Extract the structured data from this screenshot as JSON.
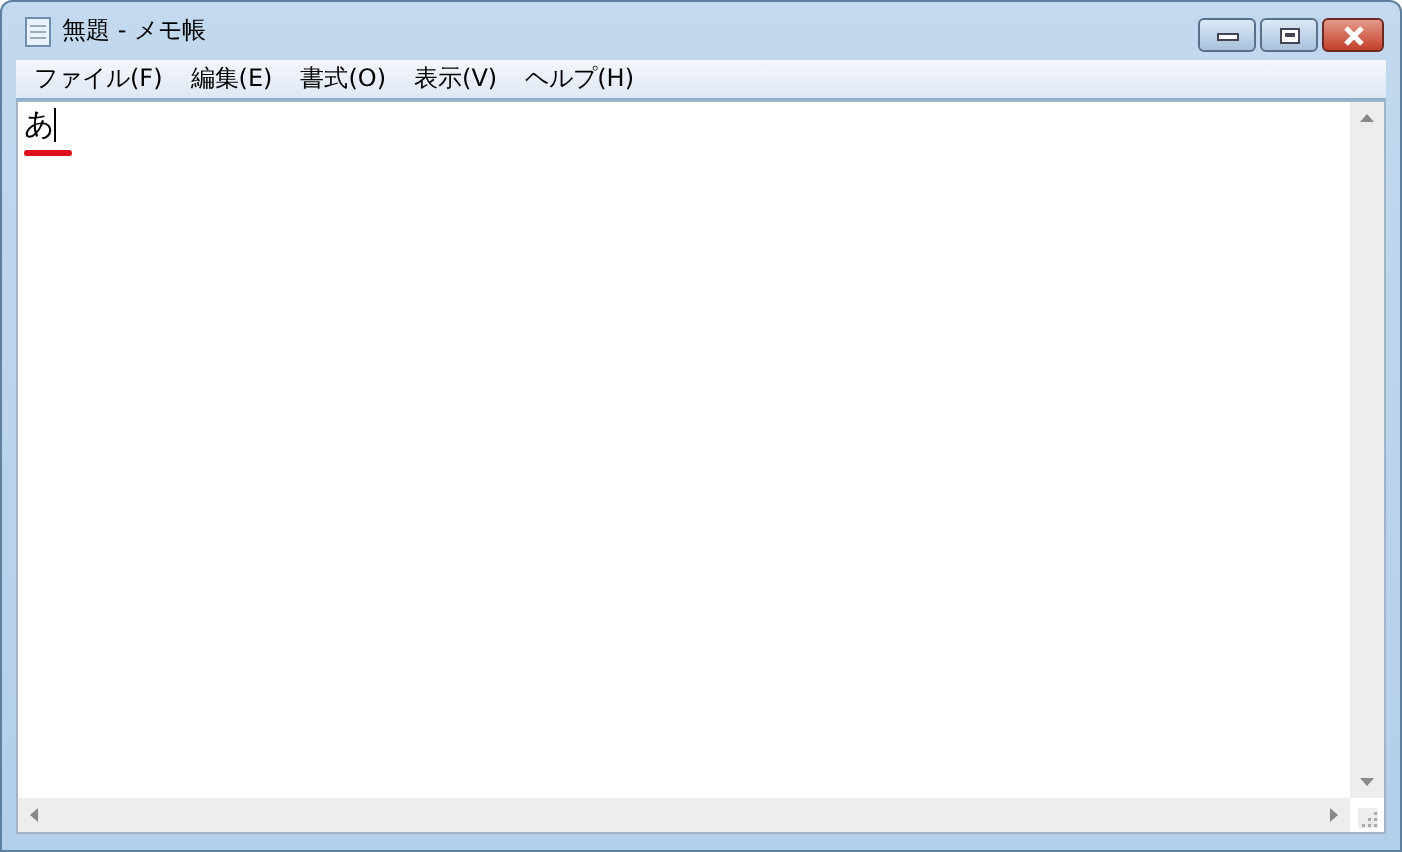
{
  "window": {
    "title": "無題 - メモ帳"
  },
  "menu": [
    {
      "label": "ファイル(F)"
    },
    {
      "label": "編集(E)"
    },
    {
      "label": "書式(O)"
    },
    {
      "label": "表示(V)"
    },
    {
      "label": "ヘルプ(H)"
    }
  ],
  "editor": {
    "value": "あ"
  }
}
